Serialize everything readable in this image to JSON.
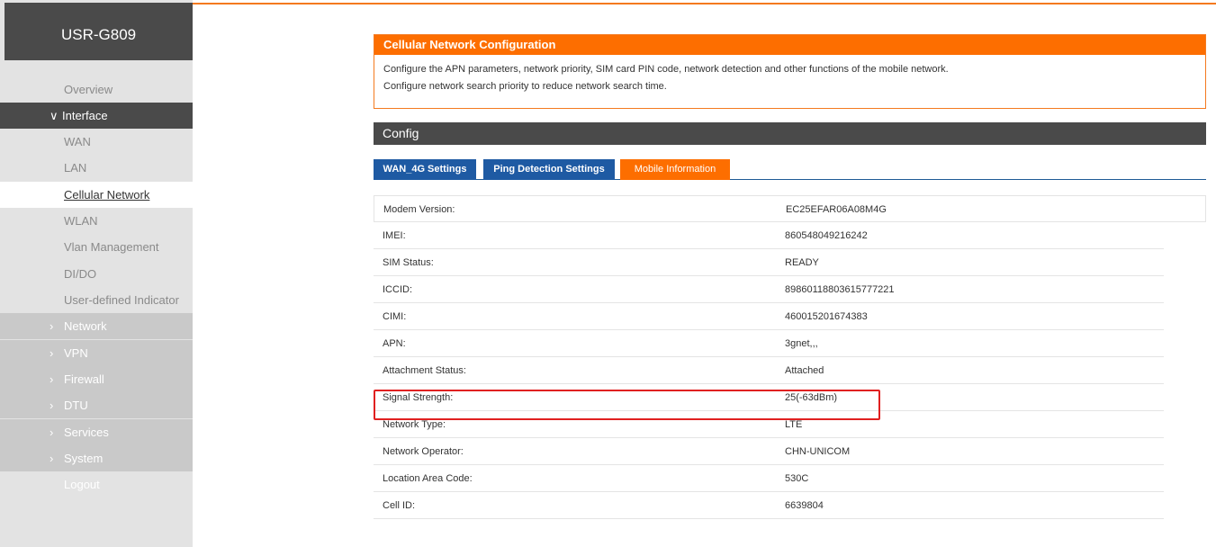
{
  "brand": "USR-G809",
  "sidebar": {
    "items": [
      {
        "label": "Overview",
        "style": "plain",
        "arrow": ""
      },
      {
        "label": "Interface",
        "style": "group-open",
        "arrow": "∨"
      },
      {
        "label": "WAN",
        "style": "plain",
        "arrow": ""
      },
      {
        "label": "LAN",
        "style": "plain",
        "arrow": ""
      },
      {
        "label": "Cellular Network",
        "style": "active",
        "arrow": ""
      },
      {
        "label": "WLAN",
        "style": "plain",
        "arrow": ""
      },
      {
        "label": "Vlan Management",
        "style": "plain",
        "arrow": ""
      },
      {
        "label": "DI/DO",
        "style": "plain",
        "arrow": ""
      },
      {
        "label": "User-defined Indicator",
        "style": "plain",
        "arrow": ""
      },
      {
        "label": "Network",
        "style": "dark",
        "arrow": "›"
      },
      {
        "label": "VPN",
        "style": "dark",
        "arrow": "›"
      },
      {
        "label": "Firewall",
        "style": "dark",
        "arrow": "›"
      },
      {
        "label": "DTU",
        "style": "dark",
        "arrow": "›"
      },
      {
        "label": "Services",
        "style": "dark",
        "arrow": "›"
      },
      {
        "label": "System",
        "style": "dark",
        "arrow": "›"
      },
      {
        "label": "Logout",
        "style": "logout",
        "arrow": ""
      }
    ]
  },
  "config_section": {
    "title": "Cellular Network Configuration",
    "line1": "Configure the APN parameters, network priority, SIM card PIN code, network detection and other functions of the mobile network.",
    "line2": "Configure network search priority to reduce network search time."
  },
  "config_bar": "Config",
  "tabs": [
    {
      "label": "WAN_4G Settings",
      "color": "blue"
    },
    {
      "label": "Ping Detection Settings",
      "color": "blue"
    },
    {
      "label": "Mobile Information",
      "color": "orange"
    }
  ],
  "info_rows": [
    {
      "label": "Modem Version:",
      "value": "EC25EFAR06A08M4G"
    },
    {
      "label": "IMEI:",
      "value": "860548049216242"
    },
    {
      "label": "SIM Status:",
      "value": "READY"
    },
    {
      "label": "ICCID:",
      "value": "89860118803615777221"
    },
    {
      "label": "CIMI:",
      "value": "460015201674383"
    },
    {
      "label": "APN:",
      "value": "3gnet,,,"
    },
    {
      "label": "Attachment Status:",
      "value": "Attached"
    },
    {
      "label": "Signal Strength:",
      "value": "25(-63dBm)"
    },
    {
      "label": "Network Type:",
      "value": "LTE"
    },
    {
      "label": "Network Operator:",
      "value": "CHN-UNICOM"
    },
    {
      "label": "Location Area Code:",
      "value": "530C"
    },
    {
      "label": "Cell ID:",
      "value": "6639804"
    }
  ],
  "colors": {
    "accent": "#fd6e00",
    "tab_blue": "#1e5aa3",
    "highlight": "#e02020"
  }
}
